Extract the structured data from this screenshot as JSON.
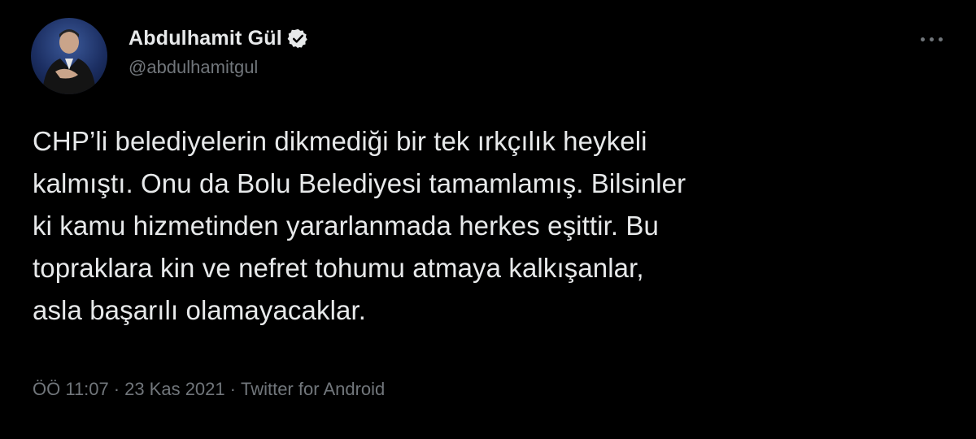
{
  "author": {
    "display_name": "Abdulhamit Gül",
    "handle": "@abdulhamitgul",
    "verified": true,
    "avatar_icon": "profile-photo"
  },
  "tweet": {
    "text_lines": [
      "CHP’li belediyelerin dikmediği bir tek ırkçılık heykeli",
      "kalmıştı. Onu da Bolu Belediyesi tamamlamış. Bilsinler",
      "ki kamu hizmetinden yararlanmada herkes eşittir. Bu",
      "topraklara kin ve nefret tohumu atmaya kalkışanlar,",
      "asla başarılı olamayacaklar."
    ],
    "time": "ÖÖ 11:07",
    "date": "23 Kas 2021",
    "source": "Twitter for Android",
    "separator": "·"
  },
  "icons": {
    "verified": "verified-badge-icon",
    "more": "more-options-icon"
  },
  "colors": {
    "background": "#000000",
    "text_primary": "#e7e9ea",
    "text_secondary": "#71767b",
    "verified_badge": "#e7e9ea"
  }
}
